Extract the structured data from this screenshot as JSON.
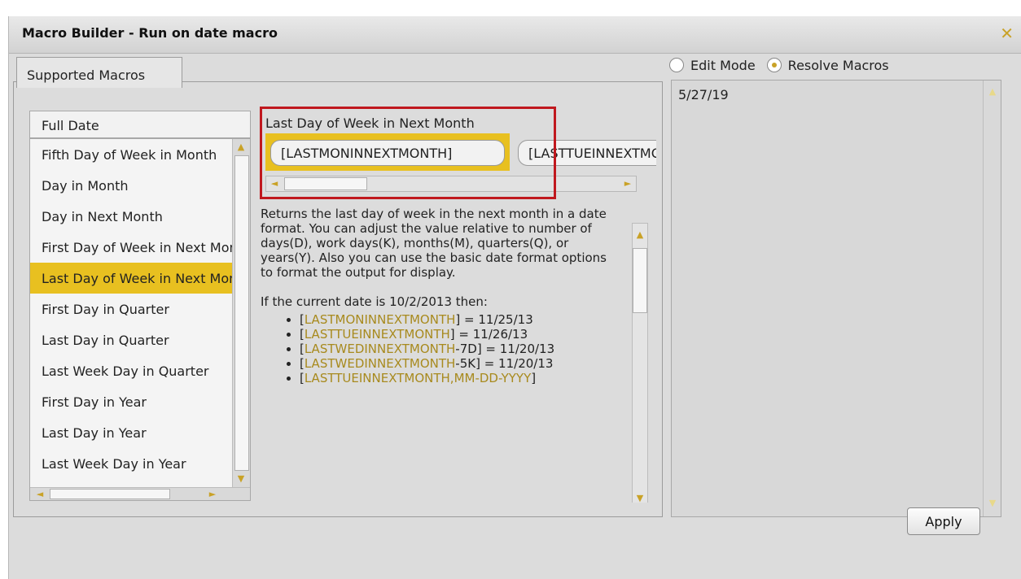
{
  "window": {
    "title": "Macro Builder - Run on date macro",
    "close_glyph": "✕"
  },
  "tabs": {
    "supported_macros": "Supported Macros"
  },
  "category_list": {
    "header": "Full Date",
    "items": [
      {
        "label": "Fifth Day of Week in Month",
        "selected": false
      },
      {
        "label": "Day in Month",
        "selected": false
      },
      {
        "label": "Day in Next Month",
        "selected": false
      },
      {
        "label": "First Day of Week in Next Month",
        "selected": false
      },
      {
        "label": "Last Day of Week in Next Month",
        "selected": true
      },
      {
        "label": "First Day in Quarter",
        "selected": false
      },
      {
        "label": "Last Day in Quarter",
        "selected": false
      },
      {
        "label": "Last Week Day in Quarter",
        "selected": false
      },
      {
        "label": "First Day in Year",
        "selected": false
      },
      {
        "label": "Last Day in Year",
        "selected": false
      },
      {
        "label": "Last Week Day in Year",
        "selected": false
      }
    ]
  },
  "macro": {
    "title": "Last Day of Week in Next Month",
    "chips": [
      "[LASTMONINNEXTMONTH]",
      "[LASTTUEINNEXTMONTH]"
    ],
    "description": "Returns the last day of week in the next month in a date format. You can adjust the value relative to number of days(D), work days(K), months(M), quarters(Q), or years(Y). Also you can use the basic date format options to format the output for display.",
    "example_intro": "If the current date is 10/2/2013 then:",
    "examples": [
      {
        "open": "[",
        "macro": "LASTMONINNEXTMONTH",
        "mod": "",
        "modcolor": "",
        "close": "] = 11/25/13"
      },
      {
        "open": "[",
        "macro": "LASTTUEINNEXTMONTH",
        "mod": "",
        "modcolor": "",
        "close": "] = 11/26/13"
      },
      {
        "open": "[",
        "macro": "LASTWEDINNEXTMONTH",
        "mod": "-7D",
        "modcolor": "",
        "close": "] = 11/20/13"
      },
      {
        "open": "[",
        "macro": "LASTWEDINNEXTMONTH",
        "mod": "-5K",
        "modcolor": "",
        "close": "] = 11/20/13"
      },
      {
        "open": "[",
        "macro": "LASTTUEINNEXTMONTH",
        "mod": ",MM-DD-YYYY",
        "modcolor": "gold",
        "close": "]"
      }
    ]
  },
  "mode": {
    "edit_label": "Edit Mode",
    "resolve_label": "Resolve Macros",
    "selected": "resolve"
  },
  "output": {
    "value": "5/27/19"
  },
  "buttons": {
    "apply": "Apply"
  },
  "colors": {
    "accent": "#e8c020",
    "highlight_box": "#c0181e",
    "macro_text": "#a88a1e"
  },
  "icons": {
    "scroll_up": "▲",
    "scroll_down": "▼",
    "scroll_left": "◄",
    "scroll_right": "►"
  }
}
